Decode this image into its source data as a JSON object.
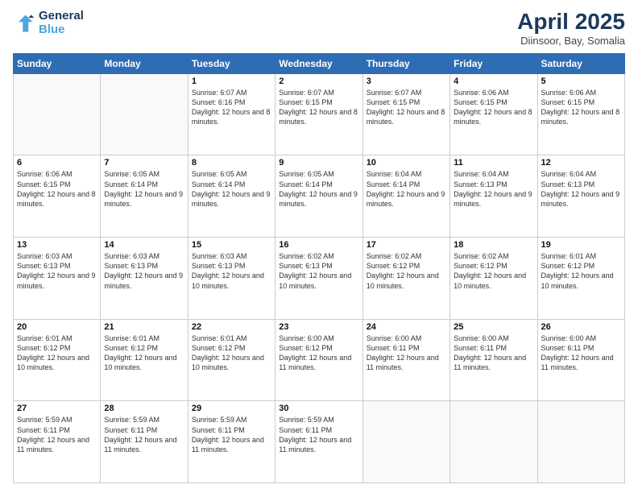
{
  "logo": {
    "line1": "General",
    "line2": "Blue"
  },
  "title": "April 2025",
  "subtitle": "Diinsoor, Bay, Somalia",
  "days_of_week": [
    "Sunday",
    "Monday",
    "Tuesday",
    "Wednesday",
    "Thursday",
    "Friday",
    "Saturday"
  ],
  "weeks": [
    [
      {
        "day": "",
        "empty": true
      },
      {
        "day": "",
        "empty": true
      },
      {
        "day": "1",
        "sunrise": "Sunrise: 6:07 AM",
        "sunset": "Sunset: 6:16 PM",
        "daylight": "Daylight: 12 hours and 8 minutes."
      },
      {
        "day": "2",
        "sunrise": "Sunrise: 6:07 AM",
        "sunset": "Sunset: 6:15 PM",
        "daylight": "Daylight: 12 hours and 8 minutes."
      },
      {
        "day": "3",
        "sunrise": "Sunrise: 6:07 AM",
        "sunset": "Sunset: 6:15 PM",
        "daylight": "Daylight: 12 hours and 8 minutes."
      },
      {
        "day": "4",
        "sunrise": "Sunrise: 6:06 AM",
        "sunset": "Sunset: 6:15 PM",
        "daylight": "Daylight: 12 hours and 8 minutes."
      },
      {
        "day": "5",
        "sunrise": "Sunrise: 6:06 AM",
        "sunset": "Sunset: 6:15 PM",
        "daylight": "Daylight: 12 hours and 8 minutes."
      }
    ],
    [
      {
        "day": "6",
        "sunrise": "Sunrise: 6:06 AM",
        "sunset": "Sunset: 6:15 PM",
        "daylight": "Daylight: 12 hours and 8 minutes."
      },
      {
        "day": "7",
        "sunrise": "Sunrise: 6:05 AM",
        "sunset": "Sunset: 6:14 PM",
        "daylight": "Daylight: 12 hours and 9 minutes."
      },
      {
        "day": "8",
        "sunrise": "Sunrise: 6:05 AM",
        "sunset": "Sunset: 6:14 PM",
        "daylight": "Daylight: 12 hours and 9 minutes."
      },
      {
        "day": "9",
        "sunrise": "Sunrise: 6:05 AM",
        "sunset": "Sunset: 6:14 PM",
        "daylight": "Daylight: 12 hours and 9 minutes."
      },
      {
        "day": "10",
        "sunrise": "Sunrise: 6:04 AM",
        "sunset": "Sunset: 6:14 PM",
        "daylight": "Daylight: 12 hours and 9 minutes."
      },
      {
        "day": "11",
        "sunrise": "Sunrise: 6:04 AM",
        "sunset": "Sunset: 6:13 PM",
        "daylight": "Daylight: 12 hours and 9 minutes."
      },
      {
        "day": "12",
        "sunrise": "Sunrise: 6:04 AM",
        "sunset": "Sunset: 6:13 PM",
        "daylight": "Daylight: 12 hours and 9 minutes."
      }
    ],
    [
      {
        "day": "13",
        "sunrise": "Sunrise: 6:03 AM",
        "sunset": "Sunset: 6:13 PM",
        "daylight": "Daylight: 12 hours and 9 minutes."
      },
      {
        "day": "14",
        "sunrise": "Sunrise: 6:03 AM",
        "sunset": "Sunset: 6:13 PM",
        "daylight": "Daylight: 12 hours and 9 minutes."
      },
      {
        "day": "15",
        "sunrise": "Sunrise: 6:03 AM",
        "sunset": "Sunset: 6:13 PM",
        "daylight": "Daylight: 12 hours and 10 minutes."
      },
      {
        "day": "16",
        "sunrise": "Sunrise: 6:02 AM",
        "sunset": "Sunset: 6:13 PM",
        "daylight": "Daylight: 12 hours and 10 minutes."
      },
      {
        "day": "17",
        "sunrise": "Sunrise: 6:02 AM",
        "sunset": "Sunset: 6:12 PM",
        "daylight": "Daylight: 12 hours and 10 minutes."
      },
      {
        "day": "18",
        "sunrise": "Sunrise: 6:02 AM",
        "sunset": "Sunset: 6:12 PM",
        "daylight": "Daylight: 12 hours and 10 minutes."
      },
      {
        "day": "19",
        "sunrise": "Sunrise: 6:01 AM",
        "sunset": "Sunset: 6:12 PM",
        "daylight": "Daylight: 12 hours and 10 minutes."
      }
    ],
    [
      {
        "day": "20",
        "sunrise": "Sunrise: 6:01 AM",
        "sunset": "Sunset: 6:12 PM",
        "daylight": "Daylight: 12 hours and 10 minutes."
      },
      {
        "day": "21",
        "sunrise": "Sunrise: 6:01 AM",
        "sunset": "Sunset: 6:12 PM",
        "daylight": "Daylight: 12 hours and 10 minutes."
      },
      {
        "day": "22",
        "sunrise": "Sunrise: 6:01 AM",
        "sunset": "Sunset: 6:12 PM",
        "daylight": "Daylight: 12 hours and 10 minutes."
      },
      {
        "day": "23",
        "sunrise": "Sunrise: 6:00 AM",
        "sunset": "Sunset: 6:12 PM",
        "daylight": "Daylight: 12 hours and 11 minutes."
      },
      {
        "day": "24",
        "sunrise": "Sunrise: 6:00 AM",
        "sunset": "Sunset: 6:11 PM",
        "daylight": "Daylight: 12 hours and 11 minutes."
      },
      {
        "day": "25",
        "sunrise": "Sunrise: 6:00 AM",
        "sunset": "Sunset: 6:11 PM",
        "daylight": "Daylight: 12 hours and 11 minutes."
      },
      {
        "day": "26",
        "sunrise": "Sunrise: 6:00 AM",
        "sunset": "Sunset: 6:11 PM",
        "daylight": "Daylight: 12 hours and 11 minutes."
      }
    ],
    [
      {
        "day": "27",
        "sunrise": "Sunrise: 5:59 AM",
        "sunset": "Sunset: 6:11 PM",
        "daylight": "Daylight: 12 hours and 11 minutes."
      },
      {
        "day": "28",
        "sunrise": "Sunrise: 5:59 AM",
        "sunset": "Sunset: 6:11 PM",
        "daylight": "Daylight: 12 hours and 11 minutes."
      },
      {
        "day": "29",
        "sunrise": "Sunrise: 5:59 AM",
        "sunset": "Sunset: 6:11 PM",
        "daylight": "Daylight: 12 hours and 11 minutes."
      },
      {
        "day": "30",
        "sunrise": "Sunrise: 5:59 AM",
        "sunset": "Sunset: 6:11 PM",
        "daylight": "Daylight: 12 hours and 11 minutes."
      },
      {
        "day": "",
        "empty": true
      },
      {
        "day": "",
        "empty": true
      },
      {
        "day": "",
        "empty": true
      }
    ]
  ]
}
